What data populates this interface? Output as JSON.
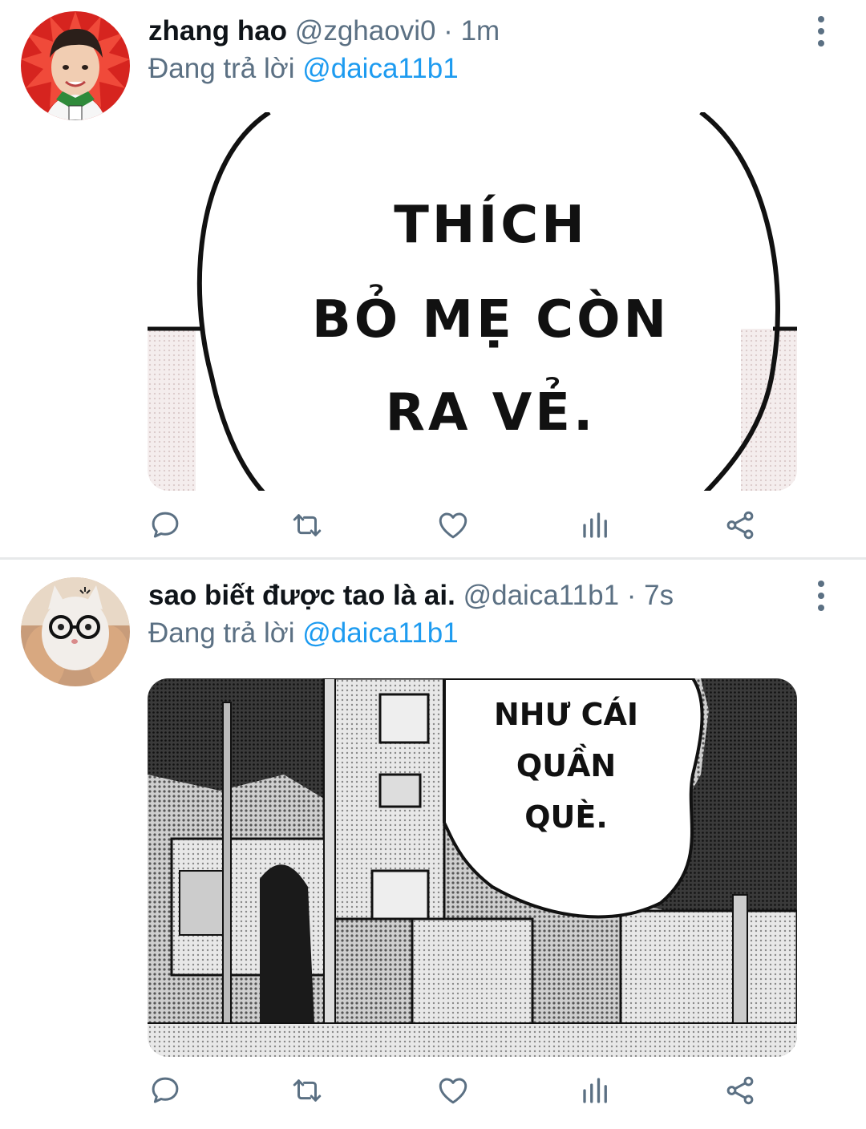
{
  "colors": {
    "accent": "#1d9bf0",
    "secondary_text": "#5b7083",
    "primary_text": "#0f1419",
    "divider": "#e7e9ea"
  },
  "tweets": [
    {
      "display_name": "zhang hao",
      "handle": "@zghaovi0",
      "separator": "·",
      "time": "1m",
      "reply_prefix": "Đang trả lời",
      "reply_to": "@daica11b1",
      "media_text": [
        "THÍCH",
        "BỎ MẸ CÒN",
        "RA VẺ."
      ],
      "avatar_icon": "avatar-photo-boy",
      "more_icon": "more-vertical-icon"
    },
    {
      "display_name": "sao biết được tao là ai.",
      "handle": "@daica11b1",
      "separator": "·",
      "time": "7s",
      "reply_prefix": "Đang trả lời",
      "reply_to": "@daica11b1",
      "media_text": [
        "NHƯ CÁI",
        "QUẦN",
        "QUÈ."
      ],
      "avatar_icon": "avatar-cat-glasses",
      "more_icon": "more-vertical-icon"
    }
  ],
  "action_icons": [
    "reply-icon",
    "retweet-icon",
    "like-icon",
    "analytics-icon",
    "share-icon"
  ]
}
